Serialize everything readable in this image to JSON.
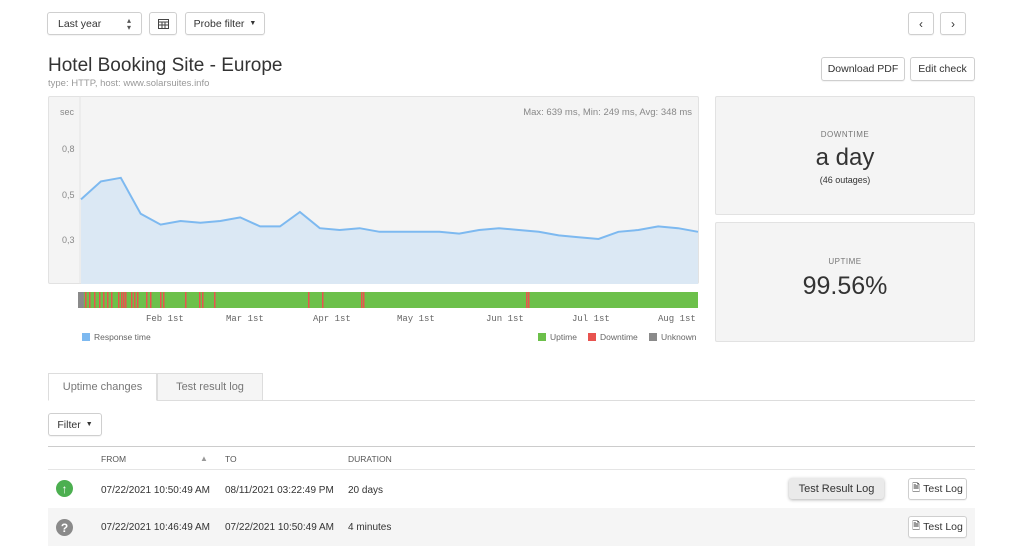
{
  "toolbar": {
    "range_label": "Last year",
    "probe_filter_label": "Probe filter"
  },
  "header": {
    "title": "Hotel Booking Site - Europe",
    "subtitle": "type: HTTP, host: www.solarsuites.info",
    "download_pdf": "Download PDF",
    "edit_check": "Edit check"
  },
  "chart_data": {
    "type": "area",
    "ylabel": "sec",
    "y_ticks": [
      "0,8",
      "0,5",
      "0,3"
    ],
    "stats": "Max: 639 ms, Min: 249 ms, Avg: 348 ms",
    "x_ticks": [
      "Feb 1st",
      "Mar 1st",
      "Apr 1st",
      "May 1st",
      "Jun 1st",
      "Jul 1st",
      "Aug 1st"
    ],
    "series": [
      {
        "name": "Response time",
        "color": "#7db9f0",
        "values": [
          0.52,
          0.62,
          0.64,
          0.44,
          0.38,
          0.4,
          0.39,
          0.4,
          0.42,
          0.37,
          0.37,
          0.45,
          0.36,
          0.35,
          0.36,
          0.34,
          0.34,
          0.34,
          0.34,
          0.33,
          0.35,
          0.36,
          0.35,
          0.34,
          0.32,
          0.31,
          0.3,
          0.34,
          0.35,
          0.37,
          0.36,
          0.34
        ]
      }
    ],
    "ylim": [
      0,
      1.0
    ],
    "status_bar": {
      "legend": [
        {
          "name": "Uptime",
          "color": "#6cc04a"
        },
        {
          "name": "Downtime",
          "color": "#e8534f"
        },
        {
          "name": "Unknown",
          "color": "#8a8a8a"
        }
      ]
    }
  },
  "downtime": {
    "label": "DOWNTIME",
    "value": "a day",
    "detail": "(46 outages)"
  },
  "uptime": {
    "label": "UPTIME",
    "value": "99.56%"
  },
  "tabs": [
    "Uptime changes",
    "Test result log"
  ],
  "filter_label": "Filter",
  "table": {
    "headers": [
      "FROM",
      "TO",
      "DURATION"
    ],
    "rows": [
      {
        "from": "07/22/2021 10:50:49 AM",
        "to": "08/11/2021 03:22:49 PM",
        "duration": "20 days",
        "action": "Test Log"
      },
      {
        "from": "07/22/2021 10:46:49 AM",
        "to": "07/22/2021 10:50:49 AM",
        "duration": "4 minutes",
        "action": "Test Log"
      }
    ]
  },
  "tooltip": "Test Result Log"
}
